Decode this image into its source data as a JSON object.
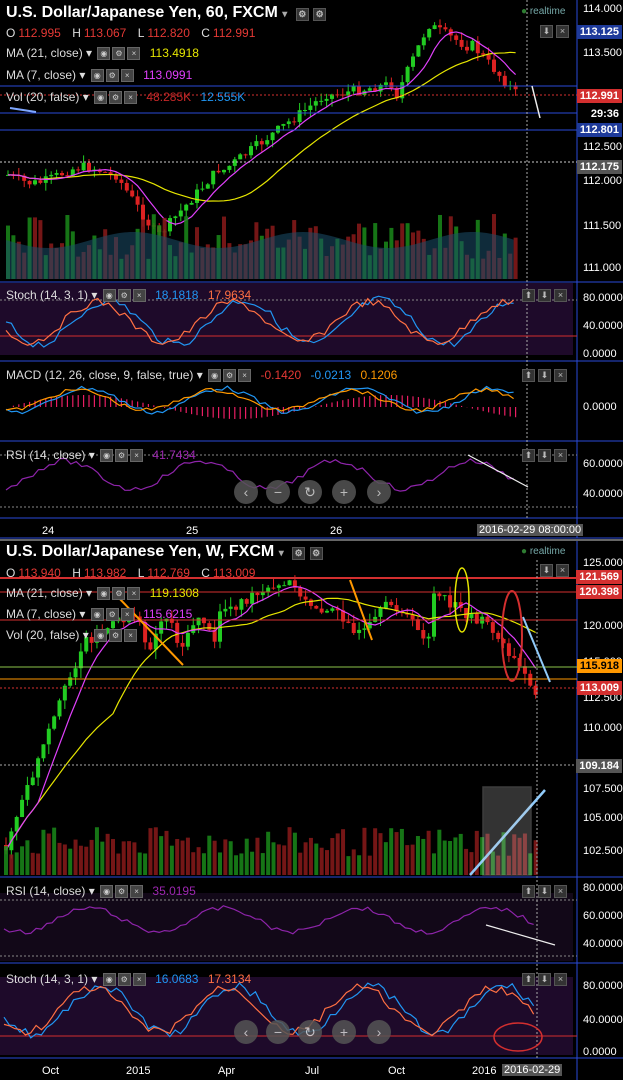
{
  "top": {
    "title": "U.S. Dollar/Japanese Yen, 60, FXCM",
    "status": "realtime",
    "ohlc": {
      "O": "112.995",
      "H": "113.067",
      "L": "112.820",
      "C": "112.991"
    },
    "studies": {
      "ma21": {
        "label": "MA (21, close)",
        "value": "113.4918",
        "color": "#e6e600"
      },
      "ma7": {
        "label": "MA (7, close)",
        "value": "113.0991",
        "color": "#e040fb"
      },
      "vol": {
        "label": "Vol (20, false)",
        "value1": "48.285K",
        "value2": "12.555K"
      }
    },
    "price_axis": [
      "114.000",
      "113.500",
      "113.000",
      "112.500",
      "112.000",
      "111.500",
      "111.000"
    ],
    "price_tags": {
      "p1": "113.125",
      "p2": "112.991",
      "p3": "29:36",
      "p4": "112.801",
      "p5": "112.175"
    },
    "stoch": {
      "label": "Stoch (14, 3, 1)",
      "v1": "18.1818",
      "v2": "17.9634",
      "axis": [
        "80.0000",
        "40.0000",
        "0.0000"
      ]
    },
    "macd": {
      "label": "MACD (12, 26, close, 9, false, true)",
      "v1": "-0.1420",
      "v2": "-0.0213",
      "v3": "0.1206",
      "axis": [
        "0.0000"
      ]
    },
    "rsi": {
      "label": "RSI (14, close)",
      "v1": "41.7434",
      "axis": [
        "60.0000",
        "40.0000"
      ]
    },
    "time_axis": [
      "24",
      "25",
      "26"
    ],
    "time_tag": "2016-02-29 08:00:00"
  },
  "bottom": {
    "title": "U.S. Dollar/Japanese Yen, W, FXCM",
    "status": "realtime",
    "ohlc": {
      "O": "113.940",
      "H": "113.982",
      "L": "112.769",
      "C": "113.009"
    },
    "studies": {
      "ma21": {
        "label": "MA (21, close)",
        "value": "119.1308",
        "color": "#e6e600"
      },
      "ma7": {
        "label": "MA (7, close)",
        "value": "115.6215",
        "color": "#e040fb"
      },
      "vol": {
        "label": "Vol (20, false)",
        "value1": "",
        "value2": ""
      }
    },
    "price_axis": [
      "125.000",
      "122.500",
      "120.000",
      "117.500",
      "115.000",
      "112.500",
      "110.000",
      "107.500",
      "105.000",
      "102.500"
    ],
    "price_tags": {
      "p1": "121.569",
      "p2": "120.398",
      "p3": "115.918",
      "p4": "113.009",
      "p5": "109.184"
    },
    "rsi": {
      "label": "RSI (14, close)",
      "v1": "35.0195",
      "axis": [
        "80.0000",
        "60.0000",
        "40.0000"
      ]
    },
    "stoch": {
      "label": "Stoch (14, 3, 1)",
      "v1": "16.0683",
      "v2": "17.3134",
      "axis": [
        "80.0000",
        "40.0000",
        "0.0000"
      ]
    },
    "time_axis": [
      "Oct",
      "2015",
      "Apr",
      "Jul",
      "Oct",
      "2016"
    ],
    "time_tag": "2016-02-29"
  },
  "nav_buttons": [
    "‹",
    "−",
    "↻",
    "+",
    "›"
  ],
  "colors": {
    "up": "#22cc22",
    "down": "#dd2222",
    "panel_bg": "#1e0a2a",
    "axis_border": "#2a4ad8"
  }
}
